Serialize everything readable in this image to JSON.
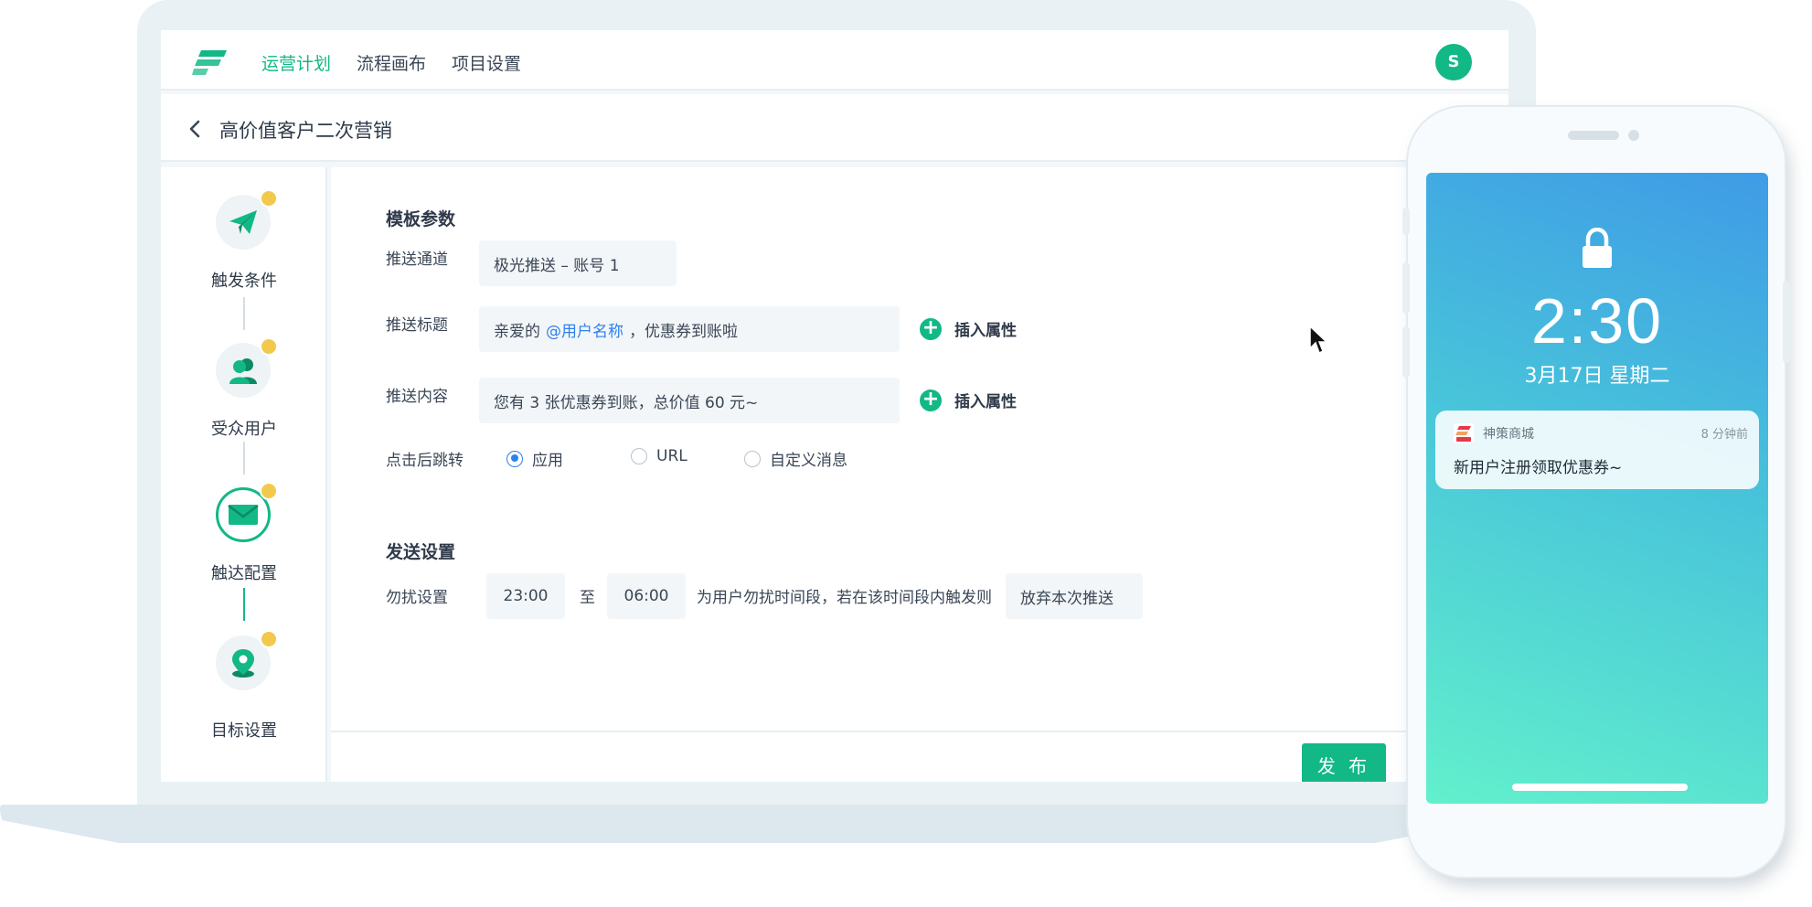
{
  "nav": {
    "tabs": [
      "运营计划",
      "流程画布",
      "项目设置"
    ],
    "active_tab": 0,
    "avatar_letter": "S",
    "accent": "#12b886"
  },
  "page": {
    "title": "高价值客户二次营销"
  },
  "steps": [
    {
      "label": "触发条件",
      "icon": "paper-plane-icon",
      "done": true
    },
    {
      "label": "受众用户",
      "icon": "users-icon",
      "done": true
    },
    {
      "label": "触达配置",
      "icon": "envelope-icon",
      "done": true,
      "current": true
    },
    {
      "label": "目标设置",
      "icon": "location-pin-icon",
      "done": true
    }
  ],
  "template": {
    "section_title": "模板参数",
    "channel_label": "推送通道",
    "channel_value": "极光推送 – 账号 1",
    "title_label": "推送标题",
    "title_prefix": "亲爱的",
    "title_variable": "@用户名称",
    "title_suffix": "，优惠券到账啦",
    "content_label": "推送内容",
    "content_value": "您有 3 张优惠券到账，总价值 60 元~",
    "insert_attr": "插入属性",
    "jump_label": "点击后跳转",
    "jump_options": [
      "应用",
      "URL",
      "自定义消息"
    ],
    "jump_selected": 0
  },
  "send": {
    "section_title": "发送设置",
    "dnd_label": "勿扰设置",
    "start_time": "23:00",
    "to": "至",
    "end_time": "06:00",
    "desc": "为用户勿扰时间段，若在该时间段内触发则",
    "action": "放弃本次推送"
  },
  "publish_label": "发 布",
  "phone": {
    "time": "2:30",
    "date": "3月17日 星期二",
    "notification": {
      "app": "神策商城",
      "time": "8 分钟前",
      "body": "新用户注册领取优惠券~"
    }
  }
}
